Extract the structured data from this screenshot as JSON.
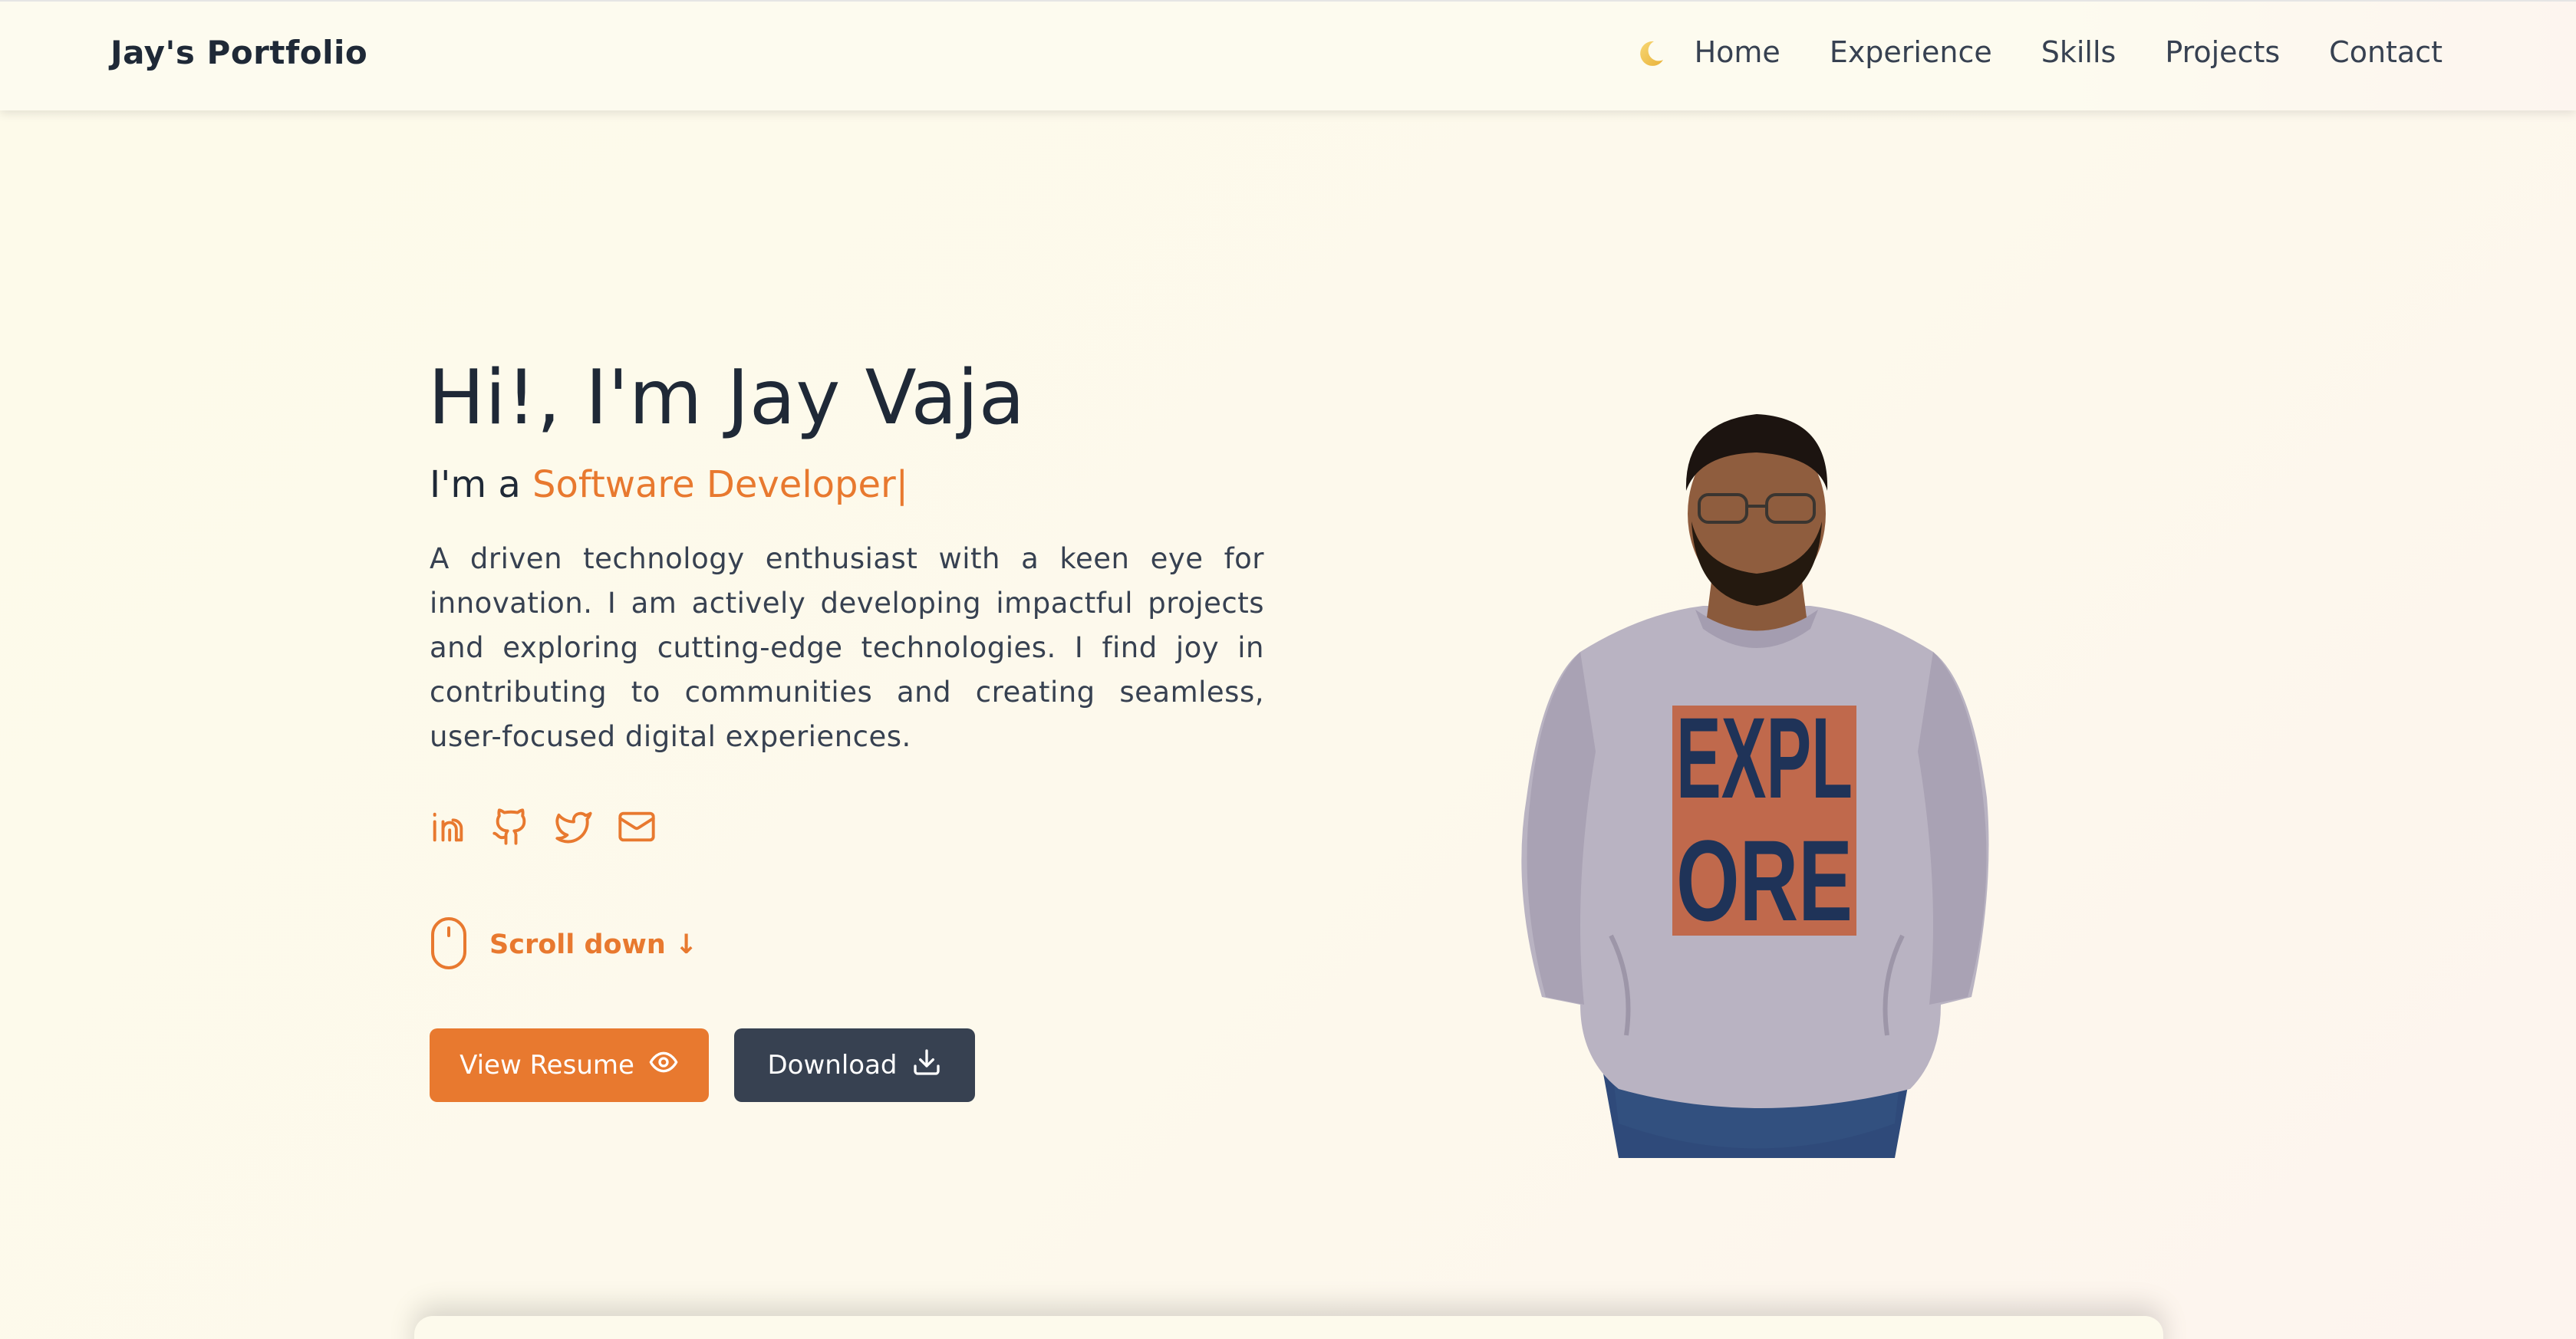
{
  "nav": {
    "brand": "Jay's Portfolio",
    "theme_toggle_icon": "moon-icon",
    "links": [
      "Home",
      "Experience",
      "Skills",
      "Projects",
      "Contact"
    ]
  },
  "hero": {
    "title": "Hi!, I'm Jay Vaja",
    "subtitle_prefix": "I'm a ",
    "subtitle_role": "Software Developer",
    "subtitle_cursor": "|",
    "description": "A driven technology enthusiast with a keen eye for innovation. I am actively developing impactful projects and exploring cutting-edge technologies. I find joy in contributing to communities and creating seamless, user-focused digital experiences.",
    "socials": [
      "linkedin-icon",
      "github-icon",
      "twitter-icon",
      "mail-icon"
    ],
    "scroll_label": "Scroll down ↓",
    "resume_label": "View Resume",
    "download_label": "Download"
  },
  "colors": {
    "accent": "#e8792f",
    "dark_button": "#374151",
    "background": "#fdfaec",
    "text": "#1f2937"
  }
}
